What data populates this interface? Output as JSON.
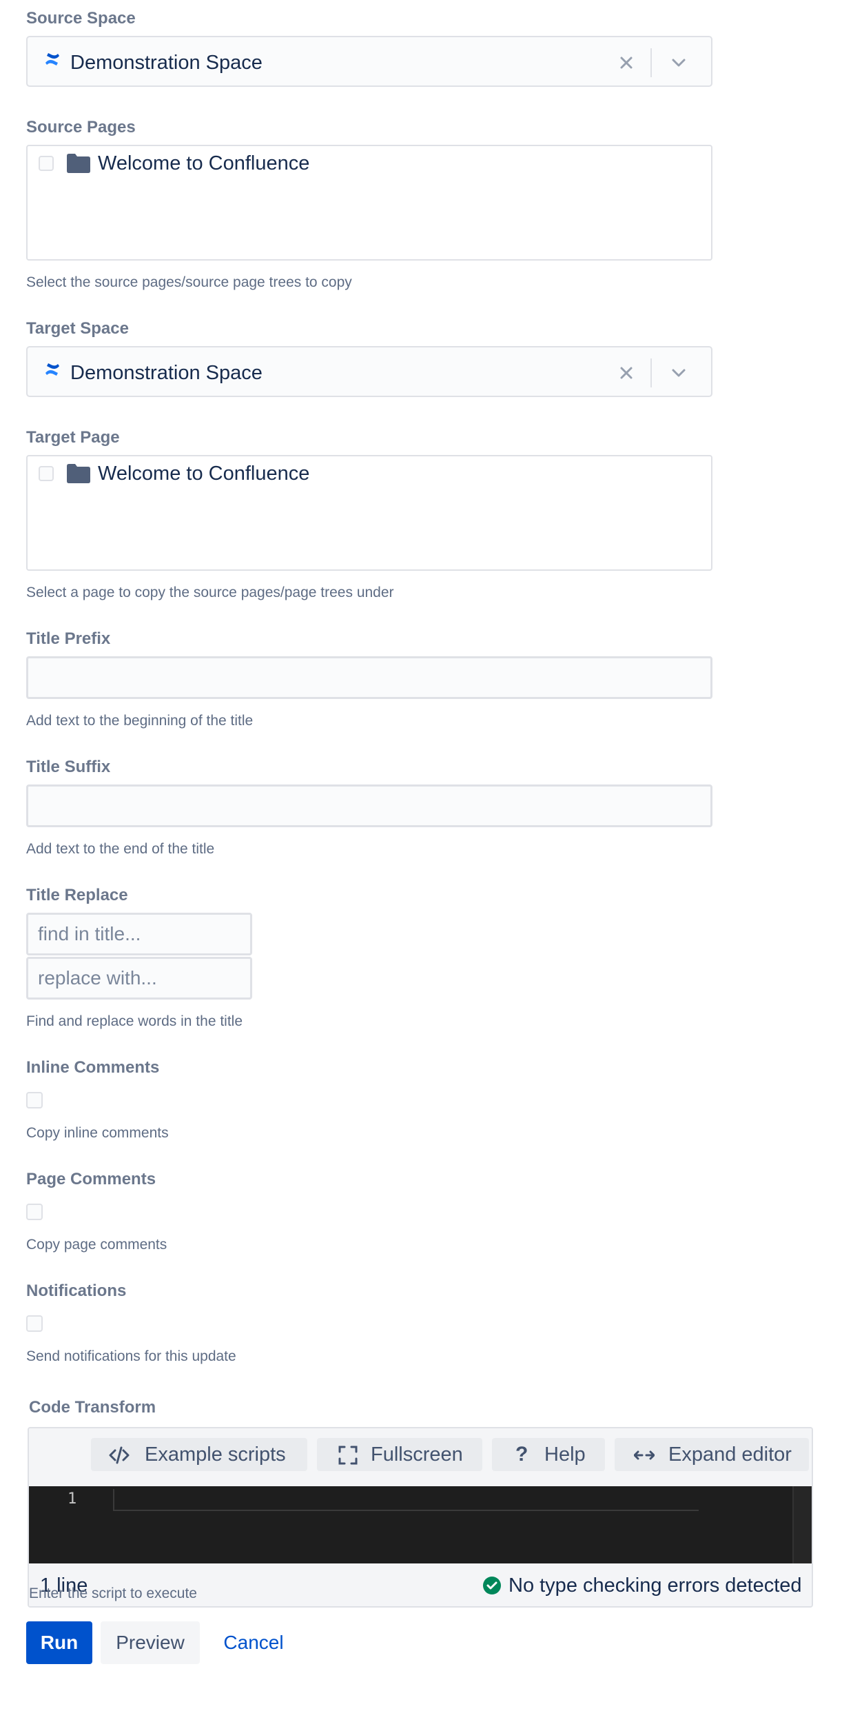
{
  "source_space": {
    "label": "Source Space",
    "value": "Demonstration Space",
    "icon": "confluence-icon"
  },
  "source_pages": {
    "label": "Source Pages",
    "items": [
      {
        "title": "Welcome to Confluence",
        "icon": "folder-icon",
        "checked": false
      }
    ],
    "help": "Select the source pages/source page trees to copy"
  },
  "target_space": {
    "label": "Target Space",
    "value": "Demonstration Space",
    "icon": "confluence-icon"
  },
  "target_page": {
    "label": "Target Page",
    "items": [
      {
        "title": "Welcome to Confluence",
        "icon": "folder-icon",
        "checked": false
      }
    ],
    "help": "Select a page to copy the source pages/page trees under"
  },
  "title_prefix": {
    "label": "Title Prefix",
    "value": "",
    "help": "Add text to the beginning of the title"
  },
  "title_suffix": {
    "label": "Title Suffix",
    "value": "",
    "help": "Add text to the end of the title"
  },
  "title_replace": {
    "label": "Title Replace",
    "find_placeholder": "find in title...",
    "replace_placeholder": "replace with...",
    "help": "Find and replace words in the title"
  },
  "inline_comments": {
    "label": "Inline Comments",
    "checked": false,
    "help": "Copy inline comments"
  },
  "page_comments": {
    "label": "Page Comments",
    "checked": false,
    "help": "Copy page comments"
  },
  "notifications": {
    "label": "Notifications",
    "checked": false,
    "help": "Send notifications for this update"
  },
  "code_transform": {
    "label": "Code Transform",
    "toolbar": {
      "example_scripts": "Example scripts",
      "fullscreen": "Fullscreen",
      "help": "Help",
      "expand_editor": "Expand editor"
    },
    "line_number": "1",
    "line_count": "1 line",
    "type_status": "No type checking errors detected",
    "help": "Enter the script to execute"
  },
  "actions": {
    "run": "Run",
    "preview": "Preview",
    "cancel": "Cancel"
  },
  "colors": {
    "primary": "#0052cc",
    "success": "#00875a",
    "label": "#6b778c",
    "border": "#dfe1e6",
    "editor_bg": "#1e1e1e"
  }
}
